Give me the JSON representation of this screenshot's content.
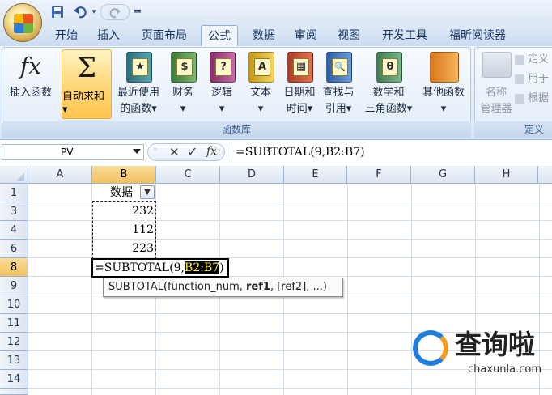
{
  "quick_access": {
    "dropdown_marker": "="
  },
  "tabs": [
    {
      "label": "开始"
    },
    {
      "label": "插入"
    },
    {
      "label": "页面布局"
    },
    {
      "label": "公式"
    },
    {
      "label": "数据"
    },
    {
      "label": "审阅"
    },
    {
      "label": "视图"
    },
    {
      "label": "开发工具"
    },
    {
      "label": "福昕阅读器"
    }
  ],
  "active_tab": "公式",
  "ribbon": {
    "insert_function": {
      "line1": "插入函数"
    },
    "autosum": {
      "line1": "自动求和",
      "line2": "▾"
    },
    "recent": {
      "line1": "最近使用",
      "line2": "的函数▾",
      "icon_symbol": "★"
    },
    "financial": {
      "line1": "财务",
      "line2": "▾",
      "icon_symbol": "$"
    },
    "logical": {
      "line1": "逻辑",
      "line2": "▾",
      "icon_symbol": "?"
    },
    "text": {
      "line1": "文本",
      "line2": "▾",
      "icon_symbol": "A"
    },
    "datetime": {
      "line1": "日期和",
      "line2": "时间▾",
      "icon_symbol": "▦"
    },
    "lookup": {
      "line1": "查找与",
      "line2": "引用▾",
      "icon_symbol": "🔍"
    },
    "math": {
      "line1": "数学和",
      "line2": "三角函数▾",
      "icon_symbol": "θ"
    },
    "more": {
      "line1": "其他函数",
      "line2": "▾"
    },
    "group_label": "函数库",
    "name_manager": {
      "line1": "名称",
      "line2": "管理器"
    },
    "define_name": "定义",
    "use_in_formula": "用于",
    "create_from_selection": "根据",
    "defined_names_group_label": "定义"
  },
  "formula_bar": {
    "name_box": "PV",
    "cancel_symbol": "✕",
    "enter_symbol": "✓",
    "fx_symbol": "fx",
    "content": "=SUBTOTAL(9,B2:B7)"
  },
  "columns": [
    "A",
    "B",
    "C",
    "D",
    "E",
    "F",
    "G",
    "H"
  ],
  "rows": [
    "1",
    "3",
    "4",
    "6",
    "8",
    "9",
    "10",
    "11",
    "12",
    "13",
    "14"
  ],
  "cells": {
    "B1": "数据",
    "B3": "232",
    "B4": "112",
    "B6": "223"
  },
  "active_cell": {
    "prefix": "=SUBTOTAL(9,",
    "highlight": "B2:B7",
    "suffix": ")"
  },
  "tooltip": {
    "func": "SUBTOTAL(function_num, ",
    "arg1": "ref1",
    "rest": ", [ref2], ...)"
  },
  "watermark": {
    "title": "查询啦",
    "url": "chaxunla.com"
  }
}
